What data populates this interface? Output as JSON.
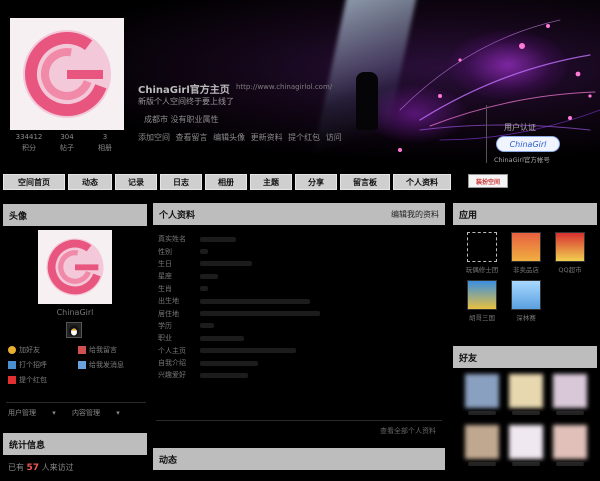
{
  "header": {
    "stats": [
      {
        "value": "334412",
        "label": "积分"
      },
      {
        "value": "304",
        "label": "帖子"
      },
      {
        "value": "3",
        "label": "相册"
      }
    ],
    "site_title": "ChinaGirl官方主页",
    "site_url": "http://www.chinagirlol.com/",
    "tagline": "新版个人空间终于要上线了",
    "location": "成都市   没有职业属性",
    "quick_links": "添加空间  查看留言  编辑头像  更新资料  提个红包  访问",
    "cert_label": "用户认证",
    "cert_badge": "ChinaGirl",
    "cert_account": "ChinaGirl官方帐号"
  },
  "nav": {
    "items": [
      "空间首页",
      "动态",
      "记录",
      "日志",
      "相册",
      "主题",
      "分享",
      "留言板",
      "个人资料"
    ],
    "extra": "装扮空间"
  },
  "left": {
    "title": "头像",
    "nickname": "ChinaGirl",
    "links": [
      "加好友",
      "给我留言",
      "打个招呼",
      "给我发消息",
      "提个红包"
    ],
    "manage": [
      "用户管理",
      "内容管理"
    ],
    "stats_title": "统计信息",
    "visits_pre": "已有",
    "visits_count": "57",
    "visits_post": "人来访过"
  },
  "profile": {
    "title": "个人资料",
    "edit": "编辑我的资料",
    "rows": [
      "真实姓名",
      "性别",
      "生日",
      "星座",
      "生肖",
      "出生地",
      "居住地",
      "学历",
      "职业",
      "个人主页",
      "自我介绍",
      "兴趣爱好"
    ],
    "see_all": "查看全部个人资料"
  },
  "feed": {
    "title": "动态"
  },
  "right": {
    "apps_title": "应用",
    "apps": [
      "玩偶修士团",
      "非卖品店",
      "QQ超市",
      "胡哥三国",
      "深林赛"
    ],
    "friends_title": "好友"
  },
  "colors": {
    "accent": "#e55555",
    "panel_header": "#bdbdbd",
    "nav_bg": "#cfcfcf"
  }
}
